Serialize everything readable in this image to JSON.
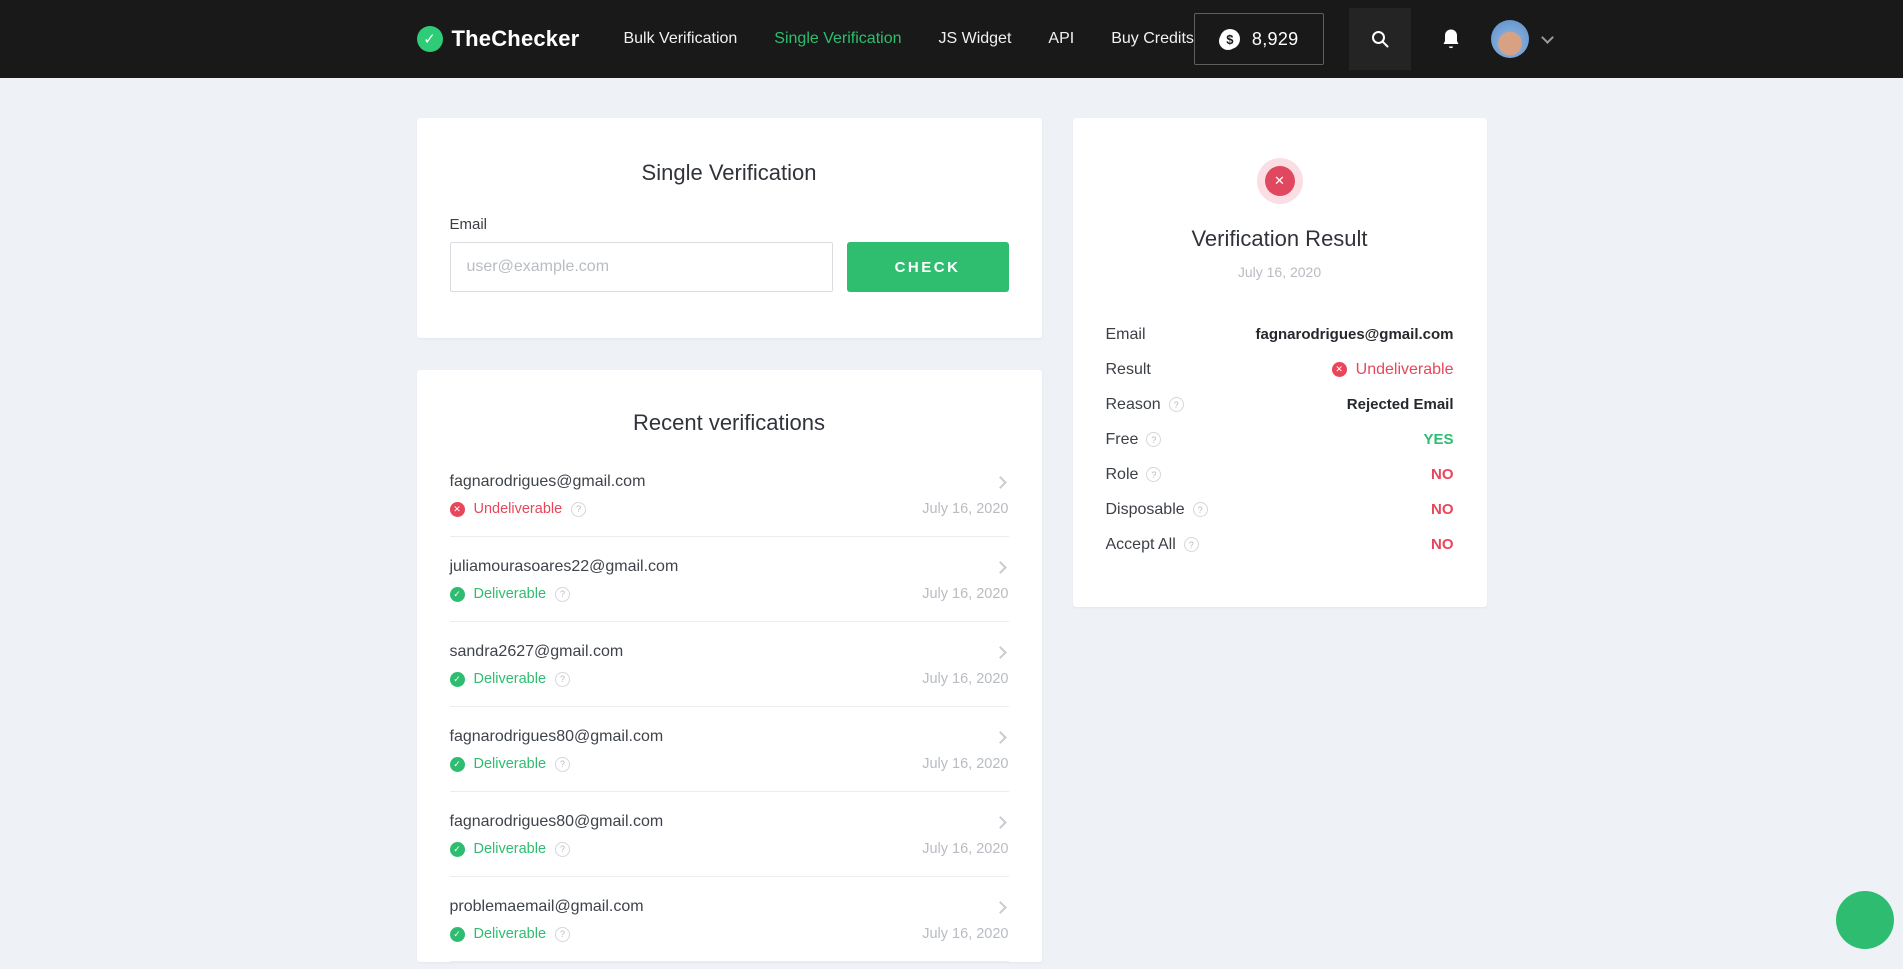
{
  "colors": {
    "accent_green": "#2ebd70",
    "error_red": "#e8475b",
    "navbar_bg": "#191919",
    "page_bg": "#eef1f6"
  },
  "navbar": {
    "brand": "TheChecker",
    "links": [
      {
        "label": "Bulk Verification",
        "active": false
      },
      {
        "label": "Single Verification",
        "active": true
      },
      {
        "label": "JS Widget",
        "active": false
      },
      {
        "label": "API",
        "active": false
      },
      {
        "label": "Buy Credits",
        "active": false
      }
    ],
    "credits": "8,929",
    "icons": [
      "coin-icon",
      "search-icon",
      "bell-icon",
      "avatar",
      "chevron-down-icon"
    ]
  },
  "single_verification": {
    "title": "Single Verification",
    "email_label": "Email",
    "email_placeholder": "user@example.com",
    "check_button": "CHECK"
  },
  "recent": {
    "title": "Recent verifications",
    "items": [
      {
        "email": "fagnarodrigues@gmail.com",
        "status": "Undeliverable",
        "status_type": "error",
        "date": "July 16, 2020"
      },
      {
        "email": "juliamourasoares22@gmail.com",
        "status": "Deliverable",
        "status_type": "ok",
        "date": "July 16, 2020"
      },
      {
        "email": "sandra2627@gmail.com",
        "status": "Deliverable",
        "status_type": "ok",
        "date": "July 16, 2020"
      },
      {
        "email": "fagnarodrigues80@gmail.com",
        "status": "Deliverable",
        "status_type": "ok",
        "date": "July 16, 2020"
      },
      {
        "email": "fagnarodrigues80@gmail.com",
        "status": "Deliverable",
        "status_type": "ok",
        "date": "July 16, 2020"
      },
      {
        "email": "problemaemail@gmail.com",
        "status": "Deliverable",
        "status_type": "ok",
        "date": "July 16, 2020"
      }
    ]
  },
  "result": {
    "title": "Verification Result",
    "date": "July 16, 2020",
    "rows": [
      {
        "label": "Email",
        "value": "fagnarodrigues@gmail.com",
        "help": false,
        "style": "bold"
      },
      {
        "label": "Result",
        "value": "Undeliverable",
        "help": false,
        "style": "error"
      },
      {
        "label": "Reason",
        "value": "Rejected Email",
        "help": true,
        "style": "bold"
      },
      {
        "label": "Free",
        "value": "YES",
        "help": true,
        "style": "yes"
      },
      {
        "label": "Role",
        "value": "NO",
        "help": true,
        "style": "no"
      },
      {
        "label": "Disposable",
        "value": "NO",
        "help": true,
        "style": "no"
      },
      {
        "label": "Accept All",
        "value": "NO",
        "help": true,
        "style": "no"
      }
    ]
  },
  "glyphs": {
    "check": "✓",
    "cross": "✕",
    "question": "?",
    "dollar": "$"
  }
}
